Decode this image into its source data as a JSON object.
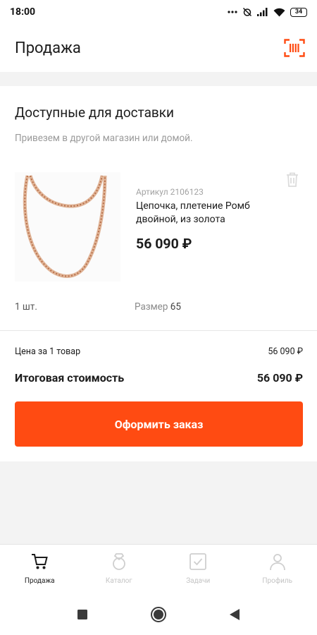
{
  "status_bar": {
    "time": "18:00",
    "battery": "34",
    "icons": [
      "dots-icon",
      "alarm-off-icon",
      "signal-icon",
      "wifi-icon",
      "battery-icon"
    ]
  },
  "header": {
    "title": "Продажа",
    "scan_icon": "barcode-scan-icon"
  },
  "delivery_section": {
    "title": "Доступные для доставки",
    "subtitle": "Привезем в другой магазин или домой."
  },
  "product": {
    "sku": "Артикул 2106123",
    "name": "Цепочка, плетение Ромб двойной, из золота",
    "price": "56 090 ₽",
    "quantity": "1 шт.",
    "size_label": "Размер",
    "size_value": "65",
    "delete_icon": "trash-icon",
    "image": "gold-chain-image"
  },
  "summary": {
    "unit_price_label": "Цена за 1 товар",
    "unit_price_value": "56 090 ₽",
    "total_label": "Итоговая стоимость",
    "total_value": "56 090 ₽"
  },
  "checkout_button": "Оформить заказ",
  "bottom_nav": {
    "items": [
      {
        "label": "Продажа",
        "icon": "cart-icon",
        "active": true
      },
      {
        "label": "Каталог",
        "icon": "ring-icon",
        "active": false
      },
      {
        "label": "Задачи",
        "icon": "checkbox-icon",
        "active": false
      },
      {
        "label": "Профиль",
        "icon": "user-icon",
        "active": false
      }
    ]
  },
  "system_nav": [
    "recents-icon",
    "home-icon",
    "back-icon"
  ],
  "colors": {
    "accent": "#ff4b12",
    "background": "#f3f3f3",
    "card": "#ffffff",
    "muted_text": "#9a9a9a",
    "inactive_nav": "#c4c4c4",
    "gold": "#d9a07f"
  }
}
